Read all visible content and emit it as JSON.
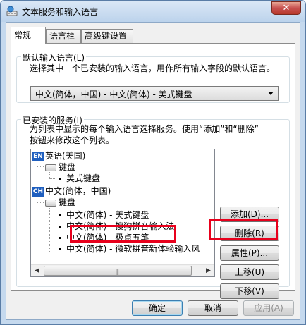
{
  "window": {
    "title": "文本服务和输入语言",
    "close_glyph": "✕"
  },
  "tabs": [
    {
      "label": "常规",
      "active": true
    },
    {
      "label": "语言栏",
      "active": false
    },
    {
      "label": "高级键设置",
      "active": false
    }
  ],
  "default_lang": {
    "group_label": "默认输入语言(L)",
    "description": "选择其中一个已安装的输入语言，用作所有输入字段的默认语言。",
    "selected": "中文(简体，中国) - 中文(简体) - 美式键盘"
  },
  "services": {
    "group_label": "已安装的服务(I)",
    "description_line1": "为列表中显示的每个输入语言选择服务。使用“添加”和“删除”",
    "description_line2": "按钮来修改这个列表。",
    "tree": {
      "lang1_badge": "EN",
      "lang1": "英语(美国)",
      "lang1_kbd": "键盘",
      "lang1_item1": "美式键盘",
      "lang2_badge": "CH",
      "lang2": "中文(简体，中国)",
      "lang2_kbd": "键盘",
      "lang2_item1": "中文(简体) - 美式键盘",
      "lang2_item2": "中文(简体) - 搜狗拼音输入法",
      "lang2_item3": "中文(简体) - 极点五笔",
      "lang2_item4": "中文(简体) - 微软拼音新体验输入风"
    },
    "buttons": {
      "add": "添加(D)...",
      "remove": "删除(R)",
      "properties": "属性(P)...",
      "move_up": "上移(U)",
      "move_down": "下移(V)"
    }
  },
  "footer": {
    "ok": "确定",
    "cancel": "取消",
    "apply": "应用(A)"
  },
  "colors": {
    "highlight": "#e8001c",
    "badge": "#1f5fbf"
  }
}
